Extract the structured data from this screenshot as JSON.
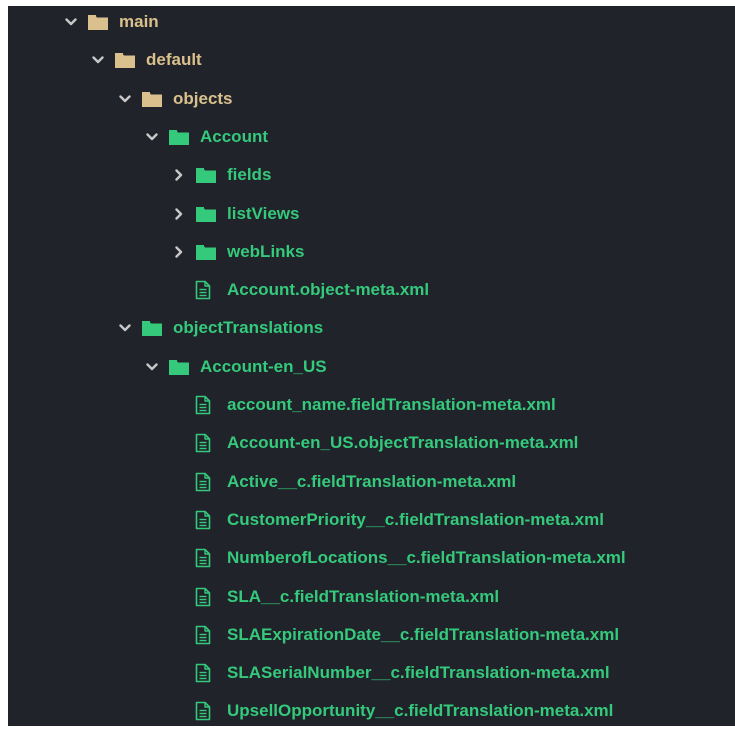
{
  "colors": {
    "background": "#20232a",
    "folder_tan": "#d9c08c",
    "git_green": "#34c97b",
    "chevron": "#c8c8c8"
  },
  "tree": [
    {
      "label": "main",
      "kind": "folder",
      "state": "expanded",
      "tone": "tan",
      "depth": 0
    },
    {
      "label": "default",
      "kind": "folder",
      "state": "expanded",
      "tone": "tan",
      "depth": 1
    },
    {
      "label": "objects",
      "kind": "folder",
      "state": "expanded",
      "tone": "tan",
      "depth": 2
    },
    {
      "label": "Account",
      "kind": "folder",
      "state": "expanded",
      "tone": "green",
      "depth": 3
    },
    {
      "label": "fields",
      "kind": "folder",
      "state": "collapsed",
      "tone": "green",
      "depth": 4
    },
    {
      "label": "listViews",
      "kind": "folder",
      "state": "collapsed",
      "tone": "green",
      "depth": 4
    },
    {
      "label": "webLinks",
      "kind": "folder",
      "state": "collapsed",
      "tone": "green",
      "depth": 4
    },
    {
      "label": "Account.object-meta.xml",
      "kind": "file",
      "tone": "green",
      "depth": 4
    },
    {
      "label": "objectTranslations",
      "kind": "folder",
      "state": "expanded",
      "tone": "green",
      "depth": 2
    },
    {
      "label": "Account-en_US",
      "kind": "folder",
      "state": "expanded",
      "tone": "green",
      "depth": 3
    },
    {
      "label": "account_name.fieldTranslation-meta.xml",
      "kind": "file",
      "tone": "green",
      "depth": 4
    },
    {
      "label": "Account-en_US.objectTranslation-meta.xml",
      "kind": "file",
      "tone": "green",
      "depth": 4
    },
    {
      "label": "Active__c.fieldTranslation-meta.xml",
      "kind": "file",
      "tone": "green",
      "depth": 4
    },
    {
      "label": "CustomerPriority__c.fieldTranslation-meta.xml",
      "kind": "file",
      "tone": "green",
      "depth": 4
    },
    {
      "label": "NumberofLocations__c.fieldTranslation-meta.xml",
      "kind": "file",
      "tone": "green",
      "depth": 4
    },
    {
      "label": "SLA__c.fieldTranslation-meta.xml",
      "kind": "file",
      "tone": "green",
      "depth": 4
    },
    {
      "label": "SLAExpirationDate__c.fieldTranslation-meta.xml",
      "kind": "file",
      "tone": "green",
      "depth": 4
    },
    {
      "label": "SLASerialNumber__c.fieldTranslation-meta.xml",
      "kind": "file",
      "tone": "green",
      "depth": 4
    },
    {
      "label": "UpsellOpportunity__c.fieldTranslation-meta.xml",
      "kind": "file",
      "tone": "green",
      "depth": 4
    }
  ]
}
